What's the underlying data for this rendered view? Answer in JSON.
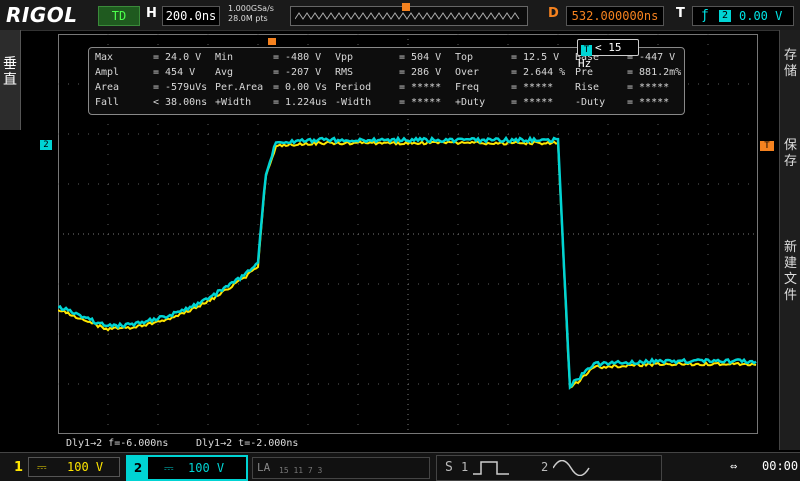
{
  "top": {
    "brand": "RIGOL",
    "run_status": "TD",
    "h_label": "H",
    "timebase": "200.0ns",
    "sample_rate": "1.000GSa/s",
    "memory_depth": "28.0M pts",
    "d_label": "D",
    "delay": "532.000000ns",
    "t_label": "T",
    "trigger_source": "2",
    "trigger_level": "0.00 V"
  },
  "left_menu": {
    "label": "垂直"
  },
  "right_menu": {
    "items": [
      "存储",
      "保存",
      "新建文件"
    ]
  },
  "measurements": [
    {
      "name": "Max",
      "value": "= 24.0 V"
    },
    {
      "name": "Min",
      "value": "= -480 V"
    },
    {
      "name": "Vpp",
      "value": "= 504 V"
    },
    {
      "name": "Top",
      "value": "= 12.5 V"
    },
    {
      "name": "Base",
      "value": "= -447 V"
    },
    {
      "name": "Ampl",
      "value": "= 454 V"
    },
    {
      "name": "Avg",
      "value": "= -207 V"
    },
    {
      "name": "RMS",
      "value": "= 286 V"
    },
    {
      "name": "Over",
      "value": "= 2.644 %"
    },
    {
      "name": "Pre",
      "value": "= 881.2m%"
    },
    {
      "name": "Area",
      "value": "= -579uVs"
    },
    {
      "name": "Per.Area",
      "value": "= 0.00 Vs"
    },
    {
      "name": "Period",
      "value": "= *****"
    },
    {
      "name": "Freq",
      "value": "= *****"
    },
    {
      "name": "Rise",
      "value": "= *****"
    },
    {
      "name": "Fall",
      "value": "< 38.00ns"
    },
    {
      "name": "+Width",
      "value": "= 1.224us"
    },
    {
      "name": "-Width",
      "value": "= *****"
    },
    {
      "name": "+Duty",
      "value": "= *****"
    },
    {
      "name": "-Duty",
      "value": "= *****"
    }
  ],
  "freq_counter": {
    "source": "T",
    "value": "< 15 Hz"
  },
  "markers": {
    "ch2": "2",
    "trigger": "T"
  },
  "delay_readouts": [
    {
      "label": "Dly1→2",
      "edge": "f",
      "value": "=-6.000ns"
    },
    {
      "label": "Dly1→2",
      "edge": "t",
      "value": "=-2.000ns"
    }
  ],
  "channels": {
    "ch1": {
      "num": "1",
      "coupling": "⎓",
      "scale": "100 V",
      "color": "#ffe600"
    },
    "ch2": {
      "num": "2",
      "coupling": "⎓",
      "scale": "100 V",
      "color": "#00d4d4"
    }
  },
  "la": {
    "label": "LA",
    "digits": "15   11   7   3"
  },
  "source": {
    "label": "S",
    "src1": "1",
    "src2": "2"
  },
  "status": {
    "time": "00:00"
  },
  "colors": {
    "ch1": "#ffe600",
    "ch2": "#00d4d4",
    "trigger": "#f5821f",
    "grid": "#5a5a5a"
  }
}
